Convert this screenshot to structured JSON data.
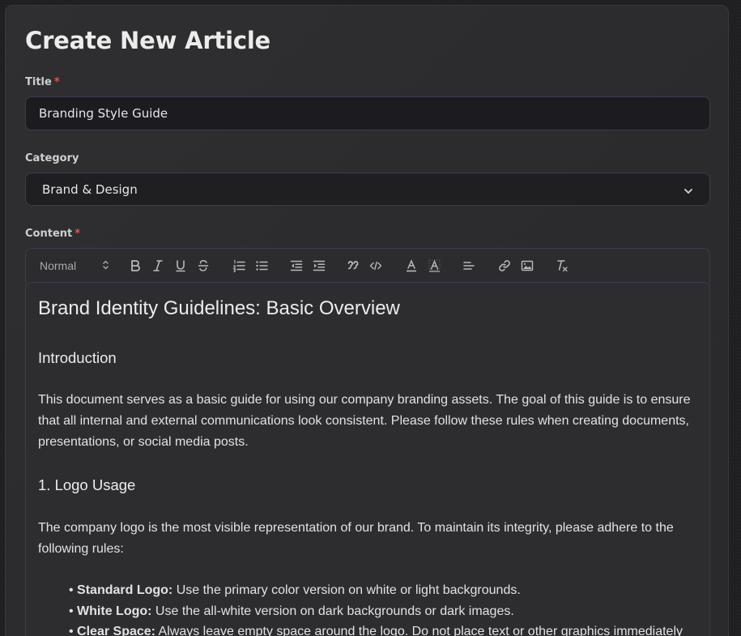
{
  "page": {
    "title": "Create New Article"
  },
  "form": {
    "title_label": "Title",
    "title_required": "*",
    "title_value": "Branding Style Guide",
    "category_label": "Category",
    "category_value": "Brand & Design",
    "content_label": "Content",
    "content_required": "*"
  },
  "toolbar": {
    "format_value": "Normal",
    "buttons": [
      {
        "name": "bold-button",
        "icon": "bold-icon"
      },
      {
        "name": "italic-button",
        "icon": "italic-icon"
      },
      {
        "name": "underline-button",
        "icon": "underline-icon"
      },
      {
        "name": "strikethrough-button",
        "icon": "strikethrough-icon"
      },
      {
        "name": "ordered-list-button",
        "icon": "ordered-list-icon"
      },
      {
        "name": "bullet-list-button",
        "icon": "bullet-list-icon"
      },
      {
        "name": "outdent-button",
        "icon": "outdent-icon"
      },
      {
        "name": "indent-button",
        "icon": "indent-icon"
      },
      {
        "name": "blockquote-button",
        "icon": "quote-icon"
      },
      {
        "name": "code-block-button",
        "icon": "code-icon"
      },
      {
        "name": "text-color-button",
        "icon": "text-color-icon"
      },
      {
        "name": "background-color-button",
        "icon": "highlight-icon"
      },
      {
        "name": "align-button",
        "icon": "align-left-icon"
      },
      {
        "name": "link-button",
        "icon": "link-icon"
      },
      {
        "name": "image-button",
        "icon": "image-icon"
      },
      {
        "name": "clear-format-button",
        "icon": "clear-format-icon"
      }
    ]
  },
  "editor": {
    "heading": "Brand Identity Guidelines: Basic Overview",
    "intro_heading": "Introduction",
    "intro_text": "This document serves as a basic guide for using our company branding assets. The goal of this guide is to ensure that all internal and external communications look consistent. Please follow these rules when creating documents, presentations, or social media posts.",
    "logo_heading": "1. Logo Usage",
    "logo_text": "The company logo is the most visible representation of our brand. To maintain its integrity, please adhere to the following rules:",
    "logo_rules": [
      {
        "term": "Standard Logo:",
        "text": " Use the primary color version on white or light backgrounds."
      },
      {
        "term": "White Logo:",
        "text": " Use the all-white version on dark backgrounds or dark images."
      },
      {
        "term": "Clear Space:",
        "text": " Always leave empty space around the logo. Do not place text or other graphics immediately"
      }
    ]
  },
  "colors": {
    "background": "#1f1f21",
    "card": "#2e2e30",
    "input_border": "#3d3a52",
    "required": "#e2554f"
  }
}
